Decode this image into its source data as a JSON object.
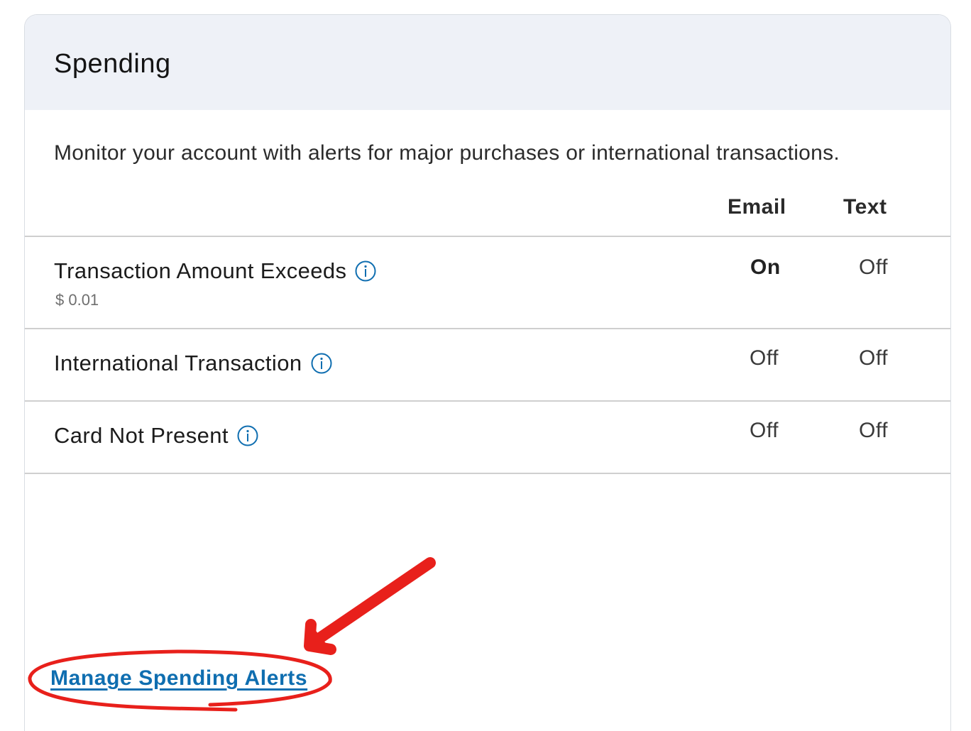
{
  "card": {
    "title": "Spending",
    "description": "Monitor your account with alerts for major purchases or international transactions."
  },
  "columns": {
    "email": "Email",
    "text": "Text"
  },
  "rows": [
    {
      "label": "Transaction Amount Exceeds",
      "sub": "$ 0.01",
      "email": "On",
      "text": "Off"
    },
    {
      "label": "International Transaction",
      "email": "Off",
      "text": "Off"
    },
    {
      "label": "Card Not Present",
      "email": "Off",
      "text": "Off"
    }
  ],
  "manage_link": "Manage Spending Alerts",
  "icons": {
    "info": "info-circle-icon"
  },
  "colors": {
    "link": "#0f6eb0",
    "header_bg": "#eef1f7",
    "annotation": "#e8201b"
  }
}
